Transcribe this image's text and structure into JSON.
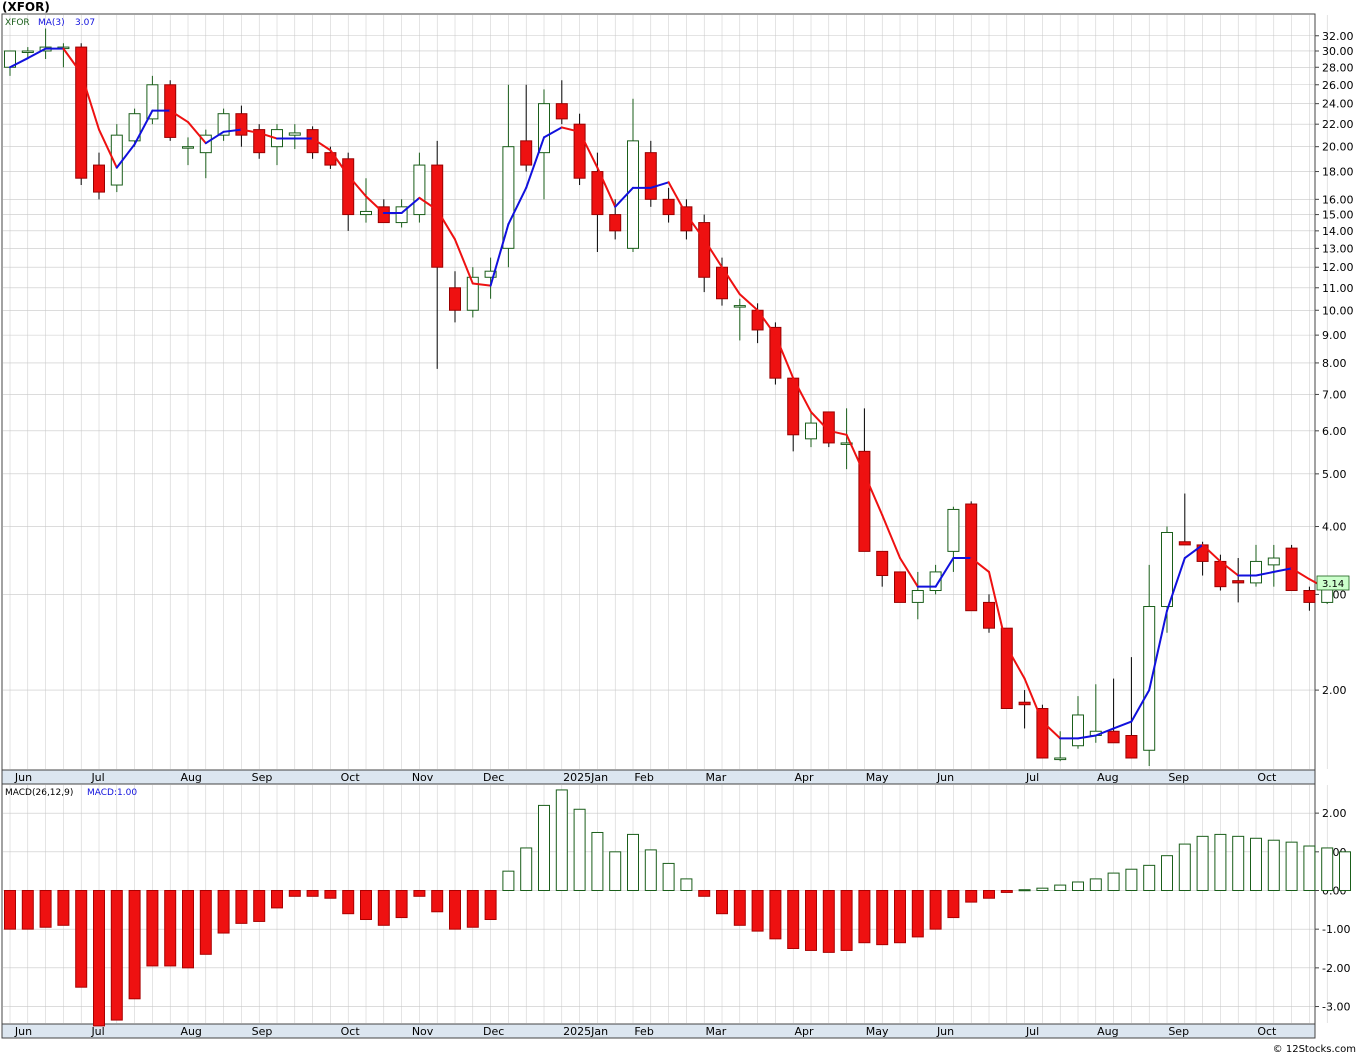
{
  "title": "(XFOR)",
  "footer": "© 12Stocks.com",
  "last_price_label": "3.14",
  "colors": {
    "up": "#1a5e1a",
    "down": "#ee1111",
    "ma_up": "#1111dd",
    "ma_down": "#ee1111",
    "macd_pos": "#1a5e1a",
    "macd_neg": "#ee1111",
    "grid": "#c8c8c8",
    "axis_bg": "#dce6f0",
    "price_tag_bg": "#ccffcc"
  },
  "chart_data": [
    {
      "type": "candlestick",
      "legend": {
        "symbol": "XFOR",
        "ma_label": "MA(3)",
        "ma_value": "3.07"
      },
      "y_scale": "log",
      "ylim": [
        1.45,
        34.5
      ],
      "y_ticks": [
        "32.00",
        "30.00",
        "28.00",
        "26.00",
        "24.00",
        "22.00",
        "20.00",
        "18.00",
        "16.00",
        "15.00",
        "14.00",
        "13.00",
        "12.00",
        "11.00",
        "10.00",
        "9.00",
        "8.00",
        "7.00",
        "6.00",
        "5.00",
        "4.00",
        "3.00",
        "2.00"
      ],
      "y_tick_values": [
        32,
        30,
        28,
        26,
        24,
        22,
        20,
        18,
        16,
        15,
        14,
        13,
        12,
        11,
        10,
        9,
        8,
        7,
        6,
        5,
        4,
        3,
        2
      ],
      "month_labels": [
        {
          "label": "Jun",
          "week": 0.5
        },
        {
          "label": "Jul",
          "week": 4.8
        },
        {
          "label": "Aug",
          "week": 9.8
        },
        {
          "label": "Sep",
          "week": 13.8
        },
        {
          "label": "Oct",
          "week": 18.8
        },
        {
          "label": "Nov",
          "week": 22.8
        },
        {
          "label": "Dec",
          "week": 26.8
        },
        {
          "label": "2025Jan",
          "week": 31.3
        },
        {
          "label": "Feb",
          "week": 35.3
        },
        {
          "label": "Mar",
          "week": 39.3
        },
        {
          "label": "Apr",
          "week": 44.3
        },
        {
          "label": "May",
          "week": 48.3
        },
        {
          "label": "Jun",
          "week": 52.3
        },
        {
          "label": "Jul",
          "week": 57.3
        },
        {
          "label": "Aug",
          "week": 61.3
        },
        {
          "label": "Sep",
          "week": 65.3
        },
        {
          "label": "Oct",
          "week": 70.3
        }
      ],
      "ohlc": [
        [
          28,
          30,
          27,
          30
        ],
        [
          30,
          30.5,
          29,
          30
        ],
        [
          30,
          33,
          29,
          30.5
        ],
        [
          30.5,
          31,
          28,
          30.5
        ],
        [
          30.5,
          31,
          17,
          17.5
        ],
        [
          18.5,
          19.5,
          16,
          16.5
        ],
        [
          17,
          22,
          16.5,
          21
        ],
        [
          20.5,
          23.5,
          20,
          23
        ],
        [
          22.5,
          27,
          22,
          26
        ],
        [
          26,
          26.5,
          20.5,
          20.8
        ],
        [
          20,
          20.8,
          18.5,
          20
        ],
        [
          19.5,
          21.5,
          17.5,
          21
        ],
        [
          21,
          23.5,
          20.5,
          23
        ],
        [
          23,
          23.8,
          20,
          21
        ],
        [
          21.5,
          22,
          19,
          19.5
        ],
        [
          20,
          22,
          18.5,
          21.5
        ],
        [
          21,
          22,
          19.8,
          21.2
        ],
        [
          21.5,
          21.8,
          19,
          19.5
        ],
        [
          19.5,
          20,
          18.2,
          18.5
        ],
        [
          19,
          19.5,
          14,
          15
        ],
        [
          15,
          17.5,
          14.5,
          15.2
        ],
        [
          15.5,
          16,
          14.5,
          14.5
        ],
        [
          14.5,
          16,
          14.2,
          15.5
        ],
        [
          15,
          19.5,
          14.5,
          18.5
        ],
        [
          18.5,
          20.5,
          7.8,
          12
        ],
        [
          11,
          11.8,
          9.5,
          10
        ],
        [
          10,
          12,
          9.7,
          11.5
        ],
        [
          11.5,
          12.5,
          10.5,
          11.8
        ],
        [
          13,
          26,
          12,
          20
        ],
        [
          20.5,
          26,
          18,
          18.5
        ],
        [
          19.5,
          25.5,
          16,
          24
        ],
        [
          24,
          26.5,
          22,
          22.5
        ],
        [
          22,
          23,
          17,
          17.5
        ],
        [
          18,
          19.5,
          12.8,
          15
        ],
        [
          15,
          16,
          13.5,
          14
        ],
        [
          13,
          24.5,
          12.8,
          20.5
        ],
        [
          19.5,
          20.5,
          15.5,
          16
        ],
        [
          16,
          16.8,
          14.5,
          15
        ],
        [
          15.5,
          16,
          13.5,
          14
        ],
        [
          14.5,
          15,
          10.8,
          11.5
        ],
        [
          12,
          12.5,
          10.2,
          10.5
        ],
        [
          10.2,
          10.5,
          8.8,
          10.2
        ],
        [
          10,
          10.3,
          8.7,
          9.2
        ],
        [
          9.3,
          9.5,
          7.3,
          7.5
        ],
        [
          7.5,
          7.5,
          5.5,
          5.9
        ],
        [
          5.8,
          6.5,
          5.6,
          6.2
        ],
        [
          6.5,
          6.5,
          5.6,
          5.7
        ],
        [
          5.7,
          6.6,
          5.1,
          5.7
        ],
        [
          5.5,
          6.6,
          3.6,
          3.6
        ],
        [
          3.6,
          3.6,
          3.1,
          3.25
        ],
        [
          3.3,
          3.3,
          2.9,
          2.9
        ],
        [
          2.9,
          3.3,
          2.7,
          3.05
        ],
        [
          3.05,
          3.4,
          3.0,
          3.3
        ],
        [
          3.6,
          4.35,
          3.3,
          4.3
        ],
        [
          4.4,
          4.45,
          2.8,
          2.8
        ],
        [
          2.9,
          3.0,
          2.55,
          2.6
        ],
        [
          2.6,
          2.6,
          1.85,
          1.85
        ],
        [
          1.9,
          2.0,
          1.7,
          1.88
        ],
        [
          1.85,
          1.88,
          1.5,
          1.5
        ],
        [
          1.49,
          1.68,
          1.48,
          1.5
        ],
        [
          1.58,
          1.95,
          1.56,
          1.8
        ],
        [
          1.65,
          2.05,
          1.6,
          1.68
        ],
        [
          1.68,
          2.1,
          1.6,
          1.6
        ],
        [
          1.65,
          2.3,
          1.55,
          1.5
        ],
        [
          1.55,
          3.4,
          1.45,
          2.85
        ],
        [
          2.85,
          4.0,
          2.55,
          3.9
        ],
        [
          3.75,
          4.6,
          3.7,
          3.7
        ],
        [
          3.7,
          3.75,
          3.25,
          3.45
        ],
        [
          3.45,
          3.55,
          3.05,
          3.1
        ],
        [
          3.18,
          3.5,
          2.9,
          3.15
        ],
        [
          3.15,
          3.7,
          3.1,
          3.45
        ],
        [
          3.4,
          3.7,
          3.1,
          3.5
        ],
        [
          3.65,
          3.7,
          3.05,
          3.05
        ],
        [
          3.05,
          3.1,
          2.8,
          2.9
        ],
        [
          2.9,
          3.22,
          2.88,
          3.14
        ]
      ],
      "ma3": [
        28,
        29.1,
        30.3,
        30.3,
        27.3,
        21.5,
        18.3,
        20.2,
        23.3,
        23.3,
        22.2,
        20.3,
        21.3,
        21.5,
        21.2,
        20.7,
        20.7,
        20.7,
        19.7,
        17.7,
        16.2,
        15.1,
        15.1,
        16.1,
        15.3,
        13.5,
        11.2,
        11.1,
        14.4,
        16.8,
        20.8,
        21.7,
        21.3,
        18.3,
        15.5,
        16.8,
        16.8,
        17.2,
        15.0,
        13.5,
        12.0,
        10.7,
        10.0,
        9.0,
        7.5,
        6.5,
        6.0,
        5.9,
        5.0,
        4.2,
        3.5,
        3.1,
        3.1,
        3.5,
        3.5,
        3.3,
        2.4,
        2.1,
        1.75,
        1.63,
        1.63,
        1.65,
        1.7,
        1.75,
        2.0,
        2.8,
        3.5,
        3.7,
        3.45,
        3.25,
        3.25,
        3.3,
        3.35,
        3.2,
        3.07
      ],
      "last_value": 3.14
    },
    {
      "type": "bar",
      "legend": {
        "label": "MACD(26,12,9)",
        "value_label": "MACD:1.00"
      },
      "ylim": [
        -3.4,
        2.65
      ],
      "y_ticks": [
        "2.00",
        "1.00",
        "0.00",
        "-1.00",
        "-2.00",
        "-3.00"
      ],
      "y_tick_values": [
        2,
        1,
        0,
        -1,
        -2,
        -3
      ],
      "values": [
        -1.0,
        -1.0,
        -0.95,
        -0.9,
        -2.5,
        -3.5,
        -3.35,
        -2.8,
        -1.95,
        -1.95,
        -2.0,
        -1.65,
        -1.1,
        -0.85,
        -0.8,
        -0.45,
        -0.15,
        -0.15,
        -0.2,
        -0.6,
        -0.75,
        -0.9,
        -0.7,
        -0.15,
        -0.55,
        -1.0,
        -0.95,
        -0.75,
        0.5,
        1.1,
        2.2,
        2.6,
        2.1,
        1.5,
        1.0,
        1.45,
        1.05,
        0.7,
        0.3,
        -0.15,
        -0.6,
        -0.9,
        -1.05,
        -1.25,
        -1.5,
        -1.55,
        -1.6,
        -1.55,
        -1.35,
        -1.4,
        -1.35,
        -1.2,
        -1.0,
        -0.7,
        -0.3,
        -0.2,
        -0.05,
        0.02,
        0.06,
        0.14,
        0.22,
        0.3,
        0.45,
        0.55,
        0.65,
        0.9,
        1.2,
        1.4,
        1.45,
        1.4,
        1.35,
        1.3,
        1.25,
        1.15,
        1.1,
        1.0
      ],
      "last_value": 1.0
    }
  ]
}
